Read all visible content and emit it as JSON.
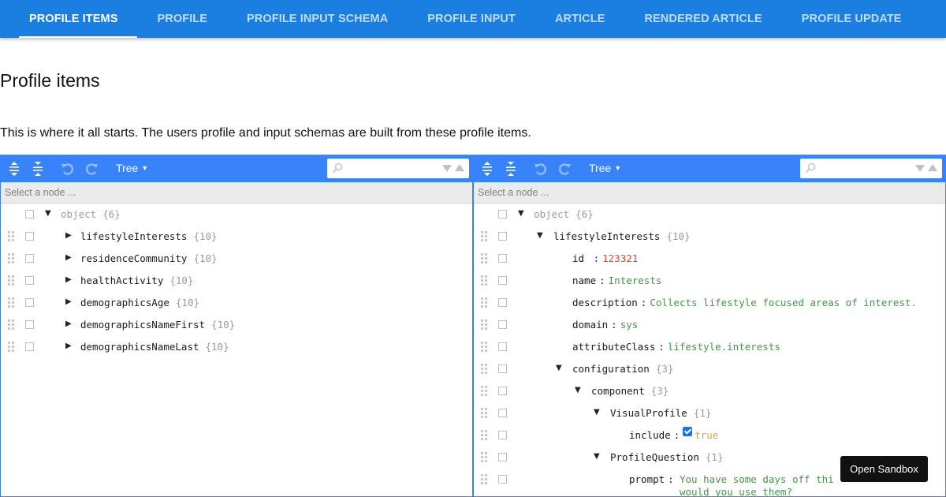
{
  "tabs": [
    "PROFILE ITEMS",
    "PROFILE",
    "PROFILE INPUT SCHEMA",
    "PROFILE INPUT",
    "ARTICLE",
    "RENDERED ARTICLE",
    "PROFILE UPDATE"
  ],
  "active_tab": "PROFILE ITEMS",
  "page": {
    "title": "Profile items",
    "description": "This is where it all starts. The users profile and input schemas are built from these profile items."
  },
  "colors": {
    "topbar": "#1a7fe0",
    "editor_menu": "#3883fa",
    "number": "#ee422e",
    "string": "#3c9c3c",
    "boolean": "#e8a33a"
  },
  "editor_left": {
    "mode_label": "Tree",
    "navbar_placeholder": "Select a node ...",
    "root": {
      "label": "object",
      "count": "{6}"
    },
    "nodes": [
      {
        "key": "lifestyleInterests",
        "count": "{10}"
      },
      {
        "key": "residenceCommunity",
        "count": "{10}"
      },
      {
        "key": "healthActivity",
        "count": "{10}"
      },
      {
        "key": "demographicsAge",
        "count": "{10}"
      },
      {
        "key": "demographicsNameFirst",
        "count": "{10}"
      },
      {
        "key": "demographicsNameLast",
        "count": "{10}"
      }
    ]
  },
  "editor_right": {
    "mode_label": "Tree",
    "navbar_placeholder": "Select a node ...",
    "root": {
      "label": "object",
      "count": "{6}"
    },
    "lifestyle": {
      "key": "lifestyleInterests",
      "count": "{10}"
    },
    "id": {
      "key": "id",
      "value": "123321"
    },
    "name": {
      "key": "name",
      "value": "Interests"
    },
    "description": {
      "key": "description",
      "value": "Collects lifestyle focused areas of interest."
    },
    "domain": {
      "key": "domain",
      "value": "sys"
    },
    "attributeClass": {
      "key": "attributeClass",
      "value": "lifestyle.interests"
    },
    "configuration": {
      "key": "configuration",
      "count": "{3}"
    },
    "component": {
      "key": "component",
      "count": "{3}"
    },
    "visualProfile": {
      "key": "VisualProfile",
      "count": "{1}"
    },
    "include": {
      "key": "include",
      "value": "true"
    },
    "profileQuestion": {
      "key": "ProfileQuestion",
      "count": "{1}"
    },
    "prompt": {
      "key": "prompt",
      "value_line1": "You have some days off thi",
      "value_line2": "would you use them?"
    }
  },
  "sandbox_label": "Open Sandbox"
}
